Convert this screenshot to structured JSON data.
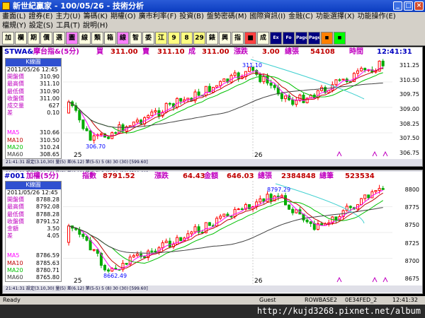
{
  "window": {
    "title": "新世紀贏家 - 100/05/26 - 技術分析",
    "btn_min": "_",
    "btn_max": "□",
    "btn_close": "×"
  },
  "menu1": [
    "畫面(L)",
    "證券(E)",
    "主力(U)",
    "籌碼(K)",
    "期權(O)",
    "廣市利率(F)",
    "投資(B)",
    "盤勢密碼(M)",
    "國際資訊(I)",
    "金融(C)",
    "功能選擇(X)",
    "功能操作(E)"
  ],
  "menu2": [
    "檔規(Y)",
    "設定(S)",
    "工具(T)",
    "說明(H)"
  ],
  "toolbar": [
    "加",
    "欄",
    "期",
    "價",
    "選",
    "圖",
    "線",
    "類",
    "箱",
    "線",
    "智",
    "委",
    "江",
    "9",
    "8",
    "29",
    "錶",
    "興",
    "指",
    "■",
    "成",
    "Ex",
    "Fo",
    "Page",
    "Page",
    "■",
    "■"
  ],
  "top": {
    "symbol": "STWA&",
    "name": "摩台指&(5分)",
    "buy_label": "買",
    "buy": "311.00",
    "sell_label": "賣",
    "sell": "311.10",
    "deal_label": "成",
    "deal": "311.00",
    "chg_label": "漲跌",
    "chg": "3.00",
    "vol_label": "總張",
    "vol": "54108",
    "time_label": "時間",
    "time": "12:41:31",
    "legend_title": "K線圖",
    "legend_date": "2011/05/26 12:45",
    "rows": [
      {
        "k": "開盤價",
        "v": "310.90"
      },
      {
        "k": "最高價",
        "v": "311.10"
      },
      {
        "k": "最低價",
        "v": "310.90"
      },
      {
        "k": "收盤價",
        "v": "311.00"
      },
      {
        "k": "成交量",
        "v": "627"
      },
      {
        "k": "差",
        "v": "0.10"
      }
    ],
    "ma": [
      {
        "k": "MA5",
        "v": "310.66"
      },
      {
        "k": "MA10",
        "v": "310.50"
      },
      {
        "k": "MA20",
        "v": "310.24"
      },
      {
        "k": "MA60",
        "v": "308.65"
      }
    ],
    "yticks": [
      "311.25",
      "310.50",
      "309.75",
      "309.00",
      "308.25",
      "307.50",
      "306.75"
    ],
    "x_labels": [
      "25",
      "26"
    ],
    "low_label": "306.70",
    "high_label": "311.10",
    "subbar": "21:41:31  設定(3.10,30)  量(5)  差(6.12)  第(5-5)  5 (8)  30 (30)  [599.60]  "
  },
  "bottom": {
    "symbol": "#001",
    "name": "加權(5分)",
    "idx_label": "指數",
    "idx": "8791.52",
    "chg_label": "漲跌",
    "chg": "64.43",
    "amt_label": "金額",
    "amt": "646.03",
    "vol_label": "總張",
    "vol": "2384848",
    "cnt_label": "總筆",
    "cnt": "523534",
    "legend_title": "K線圖",
    "legend_date": "2011/05/26 12:45",
    "rows": [
      {
        "k": "開盤價",
        "v": "8788.28"
      },
      {
        "k": "最高價",
        "v": "8792.08"
      },
      {
        "k": "最低價",
        "v": "8788.28"
      },
      {
        "k": "收盤價",
        "v": "8791.52"
      },
      {
        "k": "金額",
        "v": "3.50"
      },
      {
        "k": "差",
        "v": "4.05"
      }
    ],
    "ma": [
      {
        "k": "MA5",
        "v": "8786.59"
      },
      {
        "k": "MA10",
        "v": "8785.63"
      },
      {
        "k": "MA20",
        "v": "8780.71"
      },
      {
        "k": "MA60",
        "v": "8765.80"
      }
    ],
    "yticks": [
      "8800",
      "8775",
      "8750",
      "8725",
      "8700",
      "8675"
    ],
    "x_labels": [
      "25",
      "26"
    ],
    "low_label": "8662.49",
    "high_label": "8797.29",
    "subbar": "21:41:31  設定(3.10,30)  量(5)  差(6.12)  第(5-5)  5 (8)  30 (30)  [599.60]  "
  },
  "status": {
    "ready": "Ready",
    "guest": "Guest",
    "rowbase": "ROWBASE2",
    "code": "0E34FED_2",
    "clock": "12:41:32"
  },
  "watermark": "http://kujd3268.pixnet.net/album",
  "colors": {
    "up": "#ff0000",
    "down": "#00aa00",
    "ma5": "#ff00ff",
    "ma10": "#c00000",
    "ma20": "#00c000",
    "ma60": "#404040",
    "blue": "#0000ff"
  }
}
